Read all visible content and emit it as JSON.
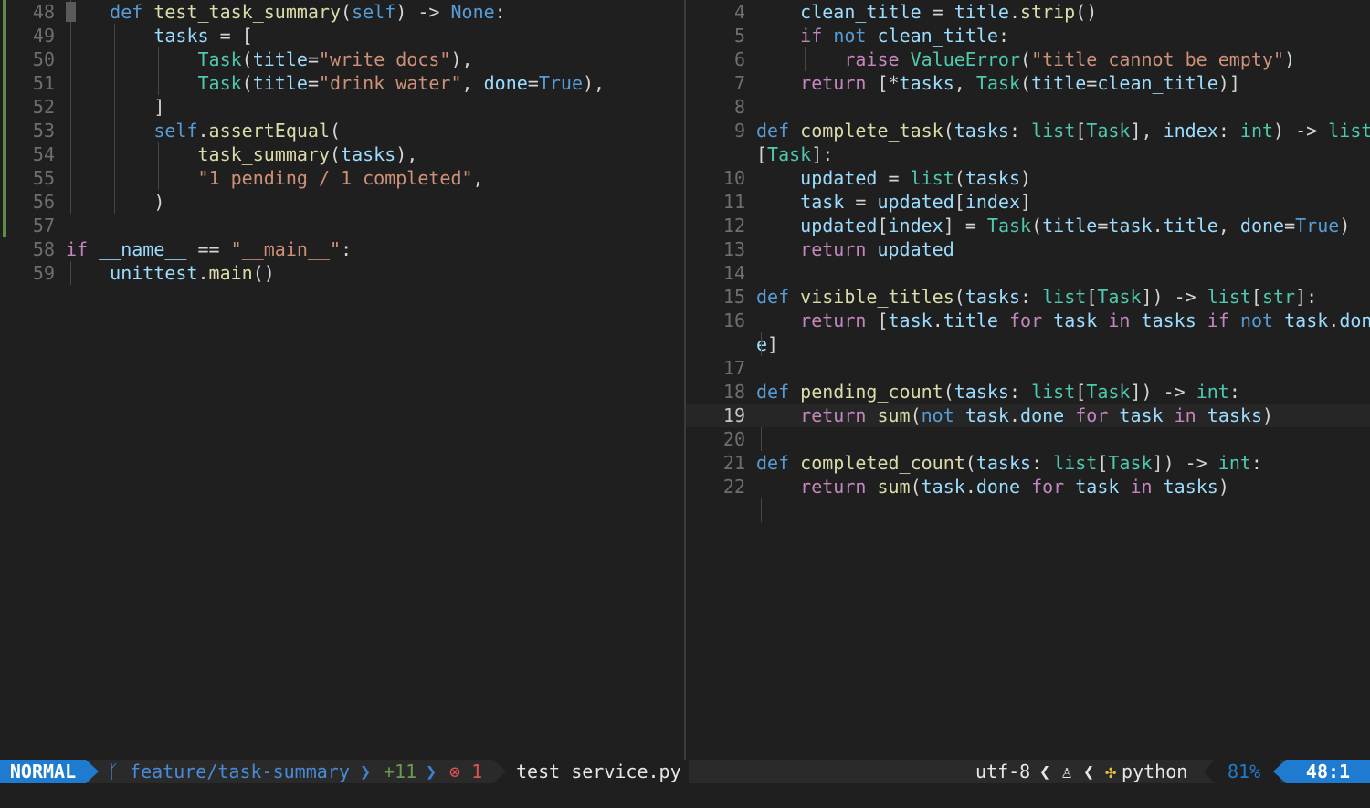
{
  "left_pane": {
    "lines": [
      {
        "n": "48",
        "tokens": [
          [
            "    ",
            ""
          ],
          [
            "def",
            "kw"
          ],
          [
            " ",
            ""
          ],
          [
            "test_task_summary",
            "fn"
          ],
          [
            "(",
            ""
          ],
          [
            "self",
            "kw"
          ],
          [
            ") -> ",
            ""
          ],
          [
            "None",
            "const"
          ],
          [
            ":",
            ""
          ]
        ]
      },
      {
        "n": "49",
        "tokens": [
          [
            "        ",
            ""
          ],
          [
            "tasks",
            "var"
          ],
          [
            " = [",
            ""
          ]
        ]
      },
      {
        "n": "50",
        "tokens": [
          [
            "            ",
            ""
          ],
          [
            "Task",
            "cls"
          ],
          [
            "(",
            ""
          ],
          [
            "title",
            "var"
          ],
          [
            "=",
            ""
          ],
          [
            "\"write docs\"",
            "str"
          ],
          [
            "),",
            ""
          ]
        ]
      },
      {
        "n": "51",
        "tokens": [
          [
            "            ",
            ""
          ],
          [
            "Task",
            "cls"
          ],
          [
            "(",
            ""
          ],
          [
            "title",
            "var"
          ],
          [
            "=",
            ""
          ],
          [
            "\"drink water\"",
            "str"
          ],
          [
            ", ",
            ""
          ],
          [
            "done",
            "var"
          ],
          [
            "=",
            ""
          ],
          [
            "True",
            "const"
          ],
          [
            "),",
            ""
          ]
        ]
      },
      {
        "n": "52",
        "tokens": [
          [
            "        ]",
            ""
          ]
        ]
      },
      {
        "n": "53",
        "tokens": [
          [
            "        ",
            ""
          ],
          [
            "self",
            "kw"
          ],
          [
            ".",
            ""
          ],
          [
            "assertEqual",
            "fn"
          ],
          [
            "(",
            ""
          ]
        ]
      },
      {
        "n": "54",
        "tokens": [
          [
            "            ",
            ""
          ],
          [
            "task_summary",
            "fn"
          ],
          [
            "(",
            ""
          ],
          [
            "tasks",
            "var"
          ],
          [
            "),",
            ""
          ]
        ]
      },
      {
        "n": "55",
        "tokens": [
          [
            "            ",
            ""
          ],
          [
            "\"1 pending / 1 completed\"",
            "str"
          ],
          [
            ",",
            ""
          ]
        ]
      },
      {
        "n": "56",
        "tokens": [
          [
            "        )",
            ""
          ]
        ]
      },
      {
        "n": "57",
        "tokens": []
      },
      {
        "n": "58",
        "tokens": [
          [
            "if",
            "kw2"
          ],
          [
            " ",
            ""
          ],
          [
            "__name__",
            "var"
          ],
          [
            " == ",
            ""
          ],
          [
            "\"__main__\"",
            "str"
          ],
          [
            ":",
            ""
          ]
        ]
      },
      {
        "n": "59",
        "tokens": [
          [
            "    ",
            ""
          ],
          [
            "unittest",
            "var"
          ],
          [
            ".",
            ""
          ],
          [
            "main",
            "fn"
          ],
          [
            "()",
            ""
          ]
        ]
      }
    ]
  },
  "right_pane": {
    "lines": [
      {
        "n": "4",
        "tokens": [
          [
            "    ",
            ""
          ],
          [
            "clean_title",
            "var"
          ],
          [
            " = ",
            ""
          ],
          [
            "title",
            "var"
          ],
          [
            ".",
            ""
          ],
          [
            "strip",
            "fn"
          ],
          [
            "()",
            ""
          ]
        ]
      },
      {
        "n": "5",
        "tokens": [
          [
            "    ",
            ""
          ],
          [
            "if",
            "kw2"
          ],
          [
            " ",
            ""
          ],
          [
            "not",
            "kw"
          ],
          [
            " ",
            ""
          ],
          [
            "clean_title",
            "var"
          ],
          [
            ":",
            ""
          ]
        ]
      },
      {
        "n": "6",
        "tokens": [
          [
            "        ",
            ""
          ],
          [
            "raise",
            "kw2"
          ],
          [
            " ",
            ""
          ],
          [
            "ValueError",
            "cls"
          ],
          [
            "(",
            ""
          ],
          [
            "\"title cannot be empty\"",
            "str"
          ],
          [
            ")",
            ""
          ]
        ]
      },
      {
        "n": "7",
        "tokens": [
          [
            "    ",
            ""
          ],
          [
            "return",
            "kw2"
          ],
          [
            " [*",
            ""
          ],
          [
            "tasks",
            "var"
          ],
          [
            ", ",
            ""
          ],
          [
            "Task",
            "cls"
          ],
          [
            "(",
            ""
          ],
          [
            "title",
            "var"
          ],
          [
            "=",
            ""
          ],
          [
            "clean_title",
            "var"
          ],
          [
            ")]",
            ""
          ]
        ]
      },
      {
        "n": "8",
        "tokens": []
      },
      {
        "n": "9",
        "tokens": [
          [
            "def",
            "kw"
          ],
          [
            " ",
            ""
          ],
          [
            "complete_task",
            "fn"
          ],
          [
            "(",
            ""
          ],
          [
            "tasks",
            "var"
          ],
          [
            ": ",
            ""
          ],
          [
            "list",
            "cls"
          ],
          [
            "[",
            ""
          ],
          [
            "Task",
            "cls"
          ],
          [
            "], ",
            ""
          ],
          [
            "index",
            "var"
          ],
          [
            ": ",
            ""
          ],
          [
            "int",
            "cls"
          ],
          [
            ") -> ",
            ""
          ],
          [
            "list",
            "cls"
          ]
        ]
      },
      {
        "n": "",
        "tokens": [
          [
            "[",
            ""
          ],
          [
            "Task",
            "cls"
          ],
          [
            "]:",
            ""
          ]
        ]
      },
      {
        "n": "10",
        "tokens": [
          [
            "    ",
            ""
          ],
          [
            "updated",
            "var"
          ],
          [
            " = ",
            ""
          ],
          [
            "list",
            "cls"
          ],
          [
            "(",
            ""
          ],
          [
            "tasks",
            "var"
          ],
          [
            ")",
            ""
          ]
        ]
      },
      {
        "n": "11",
        "tokens": [
          [
            "    ",
            ""
          ],
          [
            "task",
            "var"
          ],
          [
            " = ",
            ""
          ],
          [
            "updated",
            "var"
          ],
          [
            "[",
            ""
          ],
          [
            "index",
            "var"
          ],
          [
            "]",
            ""
          ]
        ]
      },
      {
        "n": "12",
        "tokens": [
          [
            "    ",
            ""
          ],
          [
            "updated",
            "var"
          ],
          [
            "[",
            ""
          ],
          [
            "index",
            "var"
          ],
          [
            "] = ",
            ""
          ],
          [
            "Task",
            "cls"
          ],
          [
            "(",
            ""
          ],
          [
            "title",
            "var"
          ],
          [
            "=",
            ""
          ],
          [
            "task",
            "var"
          ],
          [
            ".",
            ""
          ],
          [
            "title",
            "var"
          ],
          [
            ", ",
            ""
          ],
          [
            "done",
            "var"
          ],
          [
            "=",
            ""
          ],
          [
            "True",
            "const"
          ],
          [
            ")",
            ""
          ]
        ]
      },
      {
        "n": "13",
        "tokens": [
          [
            "    ",
            ""
          ],
          [
            "return",
            "kw2"
          ],
          [
            " ",
            ""
          ],
          [
            "updated",
            "var"
          ]
        ]
      },
      {
        "n": "14",
        "tokens": []
      },
      {
        "n": "15",
        "tokens": [
          [
            "def",
            "kw"
          ],
          [
            " ",
            ""
          ],
          [
            "visible_titles",
            "fn"
          ],
          [
            "(",
            ""
          ],
          [
            "tasks",
            "var"
          ],
          [
            ": ",
            ""
          ],
          [
            "list",
            "cls"
          ],
          [
            "[",
            ""
          ],
          [
            "Task",
            "cls"
          ],
          [
            "]) -> ",
            ""
          ],
          [
            "list",
            "cls"
          ],
          [
            "[",
            ""
          ],
          [
            "str",
            "cls"
          ],
          [
            "]:",
            ""
          ]
        ]
      },
      {
        "n": "16",
        "tokens": [
          [
            "    ",
            ""
          ],
          [
            "return",
            "kw2"
          ],
          [
            " [",
            ""
          ],
          [
            "task",
            "var"
          ],
          [
            ".",
            ""
          ],
          [
            "title",
            "var"
          ],
          [
            " ",
            ""
          ],
          [
            "for",
            "kw2"
          ],
          [
            " ",
            ""
          ],
          [
            "task",
            "var"
          ],
          [
            " ",
            ""
          ],
          [
            "in",
            "kw2"
          ],
          [
            " ",
            ""
          ],
          [
            "tasks",
            "var"
          ],
          [
            " ",
            ""
          ],
          [
            "if",
            "kw2"
          ],
          [
            " ",
            ""
          ],
          [
            "not",
            "kw"
          ],
          [
            " ",
            ""
          ],
          [
            "task",
            "var"
          ],
          [
            ".",
            ""
          ],
          [
            "don",
            "var"
          ]
        ]
      },
      {
        "n": "",
        "tokens": [
          [
            "e",
            "var"
          ],
          [
            "]",
            ""
          ]
        ]
      },
      {
        "n": "17",
        "tokens": []
      },
      {
        "n": "18",
        "tokens": [
          [
            "def",
            "kw"
          ],
          [
            " ",
            ""
          ],
          [
            "pending_count",
            "fn"
          ],
          [
            "(",
            ""
          ],
          [
            "tasks",
            "var"
          ],
          [
            ": ",
            ""
          ],
          [
            "list",
            "cls"
          ],
          [
            "[",
            ""
          ],
          [
            "Task",
            "cls"
          ],
          [
            "]) -> ",
            ""
          ],
          [
            "int",
            "cls"
          ],
          [
            ":",
            ""
          ]
        ]
      },
      {
        "n": "19",
        "tokens": [
          [
            "    ",
            ""
          ],
          [
            "return",
            "kw2"
          ],
          [
            " ",
            ""
          ],
          [
            "sum",
            "fn"
          ],
          [
            "(",
            ""
          ],
          [
            "not",
            "kw"
          ],
          [
            " ",
            ""
          ],
          [
            "task",
            "var"
          ],
          [
            ".",
            ""
          ],
          [
            "done",
            "var"
          ],
          [
            " ",
            ""
          ],
          [
            "for",
            "kw2"
          ],
          [
            " ",
            ""
          ],
          [
            "task",
            "var"
          ],
          [
            " ",
            ""
          ],
          [
            "in",
            "kw2"
          ],
          [
            " ",
            ""
          ],
          [
            "tasks",
            "var"
          ],
          [
            ")",
            ""
          ]
        ]
      },
      {
        "n": "20",
        "tokens": []
      },
      {
        "n": "21",
        "tokens": [
          [
            "def",
            "kw"
          ],
          [
            " ",
            ""
          ],
          [
            "completed_count",
            "fn"
          ],
          [
            "(",
            ""
          ],
          [
            "tasks",
            "var"
          ],
          [
            ": ",
            ""
          ],
          [
            "list",
            "cls"
          ],
          [
            "[",
            ""
          ],
          [
            "Task",
            "cls"
          ],
          [
            "]) -> ",
            ""
          ],
          [
            "int",
            "cls"
          ],
          [
            ":",
            ""
          ]
        ]
      },
      {
        "n": "22",
        "tokens": [
          [
            "    ",
            ""
          ],
          [
            "return",
            "kw2"
          ],
          [
            " ",
            ""
          ],
          [
            "sum",
            "fn"
          ],
          [
            "(",
            ""
          ],
          [
            "task",
            "var"
          ],
          [
            ".",
            ""
          ],
          [
            "done",
            "var"
          ],
          [
            " ",
            ""
          ],
          [
            "for",
            "kw2"
          ],
          [
            " ",
            ""
          ],
          [
            "task",
            "var"
          ],
          [
            " ",
            ""
          ],
          [
            "in",
            "kw2"
          ],
          [
            " ",
            ""
          ],
          [
            "tasks",
            "var"
          ],
          [
            ")",
            ""
          ]
        ]
      }
    ]
  },
  "statusbar": {
    "mode": "NORMAL",
    "branch_icon": "git-branch-icon",
    "branch": "feature/task-summary",
    "added": "+11",
    "error_icon": "error-circle-icon",
    "errors": "1",
    "filename": "test_service.py",
    "encoding": "utf-8",
    "os_icon": "linux-icon",
    "language_icon": "python-icon",
    "language": "python",
    "progress": "81%",
    "position": "48:1"
  },
  "colors": {
    "accent": "#1e7bd0",
    "git_added": "#5f8a47",
    "error": "#e05252"
  }
}
